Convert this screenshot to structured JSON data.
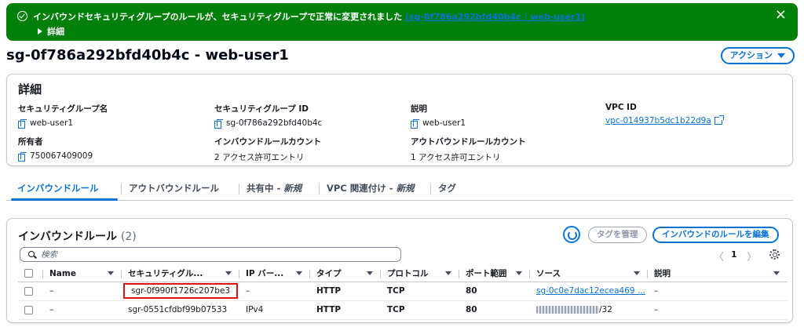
{
  "flash": {
    "message": "インバウンドセキュリティグループのルールが、セキュリティグループで正常に変更されました",
    "link": "(sg-0f786a292bfd40b4c | web-user1)",
    "details": "詳細",
    "close": "×",
    "color": "#037f0c"
  },
  "page": {
    "title": "sg-0f786a292bfd40b4c - web-user1",
    "action_label": "アクション"
  },
  "details": {
    "heading": "詳細",
    "sg_name_label": "セキュリティグループ名",
    "sg_name": "web-user1",
    "sg_id_label": "セキュリティグループ ID",
    "sg_id": "sg-0f786a292bfd40b4c",
    "description_label": "説明",
    "description": "web-user1",
    "vpc_label": "VPC ID",
    "vpc_id": "vpc-014937b5dc1b22d9a",
    "owner_label": "所有者",
    "owner": "750067409009",
    "inbound_count_label": "インバウンドルールカウント",
    "inbound_count": "2 アクセス許可エントリ",
    "outbound_count_label": "アウトバウンドルールカウント",
    "outbound_count": "1 アクセス許可エントリ"
  },
  "tabs": [
    {
      "label": "インバウンドルール"
    },
    {
      "label": "アウトバウンドルール"
    },
    {
      "label": "共有中 - ",
      "tag": "新規"
    },
    {
      "label": "VPC 関連付け - ",
      "tag": "新規"
    },
    {
      "label": "タグ"
    }
  ],
  "rules": {
    "title": "インバウンドルール",
    "count": "(2)",
    "manage_tags": "タグを管理",
    "edit_rules": "インバウンドのルールを編集",
    "search_placeholder": "検索",
    "page": "1",
    "prev": "〈",
    "next": "〉",
    "columns": [
      "Name",
      "セキュリティグル...",
      "IP バー...",
      "タイプ",
      "プロトコル",
      "ポート範囲",
      "ソース",
      "説明"
    ],
    "rows": [
      {
        "name": "–",
        "rule_id": "sgr-0f990f1726c207be3",
        "ip": "–",
        "type": "HTTP",
        "protocol": "TCP",
        "port": "80",
        "source": "sg-0c0e7dac12ecea469 ...",
        "desc": "–"
      },
      {
        "name": "–",
        "rule_id": "sgr-0551cfdbf99b07533",
        "ip": "IPv4",
        "type": "HTTP",
        "protocol": "TCP",
        "port": "80",
        "source": "/32",
        "desc": "–"
      }
    ]
  },
  "colors": {
    "accent": "#0972d3",
    "highlight": "#e01010"
  }
}
